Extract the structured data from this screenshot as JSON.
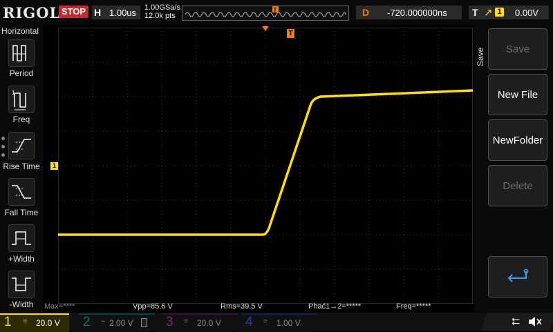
{
  "header": {
    "brand": "RIGOL",
    "run_state": "STOP",
    "horizontal_label": "H",
    "horizontal_scale": "1.00us",
    "sample_rate": "1.00GSa/s",
    "memory_depth": "12.0k pts",
    "delay_label": "D",
    "delay_value": "-720.000000ns",
    "trigger_label": "T",
    "trigger_source": "1",
    "trigger_level": "0.00V"
  },
  "left_menu": {
    "title": "Horizontal",
    "items": [
      {
        "label": "Period",
        "icon": "period-icon"
      },
      {
        "label": "Freq",
        "icon": "frequency-icon"
      },
      {
        "label": "Rise Time",
        "icon": "rise-time-icon"
      },
      {
        "label": "Fall Time",
        "icon": "fall-time-icon"
      },
      {
        "label": "+Width",
        "icon": "positive-width-icon"
      },
      {
        "label": "-Width",
        "icon": "negative-width-icon"
      }
    ]
  },
  "right_menu": {
    "title": "Save",
    "buttons": [
      {
        "label": "Save",
        "enabled": false
      },
      {
        "label": "New File",
        "enabled": true
      },
      {
        "label": "NewFolder",
        "enabled": true
      },
      {
        "label": "Delete",
        "enabled": false
      },
      {
        "label": "",
        "icon": "return-icon",
        "enabled": true
      }
    ]
  },
  "measurements": {
    "max": "Max=****",
    "vpp": "Vpp=85.6 V",
    "rms": "Rms=39.5 V",
    "phase": "Phać1→2=*****",
    "freq": "Freq=*****"
  },
  "channels": [
    {
      "num": "1",
      "coupling": "=",
      "scale": "20.0 V",
      "color": "#ffe000",
      "active": true
    },
    {
      "num": "2",
      "coupling": "~",
      "scale": "2.00 V",
      "color": "#00c8c8",
      "active": false
    },
    {
      "num": "3",
      "coupling": "=",
      "scale": "20.0 V",
      "color": "#e040e0",
      "active": false
    },
    {
      "num": "4",
      "coupling": "=",
      "scale": "1.00 V",
      "color": "#2060ff",
      "active": false
    }
  ],
  "markers": {
    "channel1_ground": "1",
    "trigger_position": "T"
  },
  "colors": {
    "channel1": "#ffe000",
    "trigger": "#f57c00",
    "stop": "#c8282c"
  }
}
